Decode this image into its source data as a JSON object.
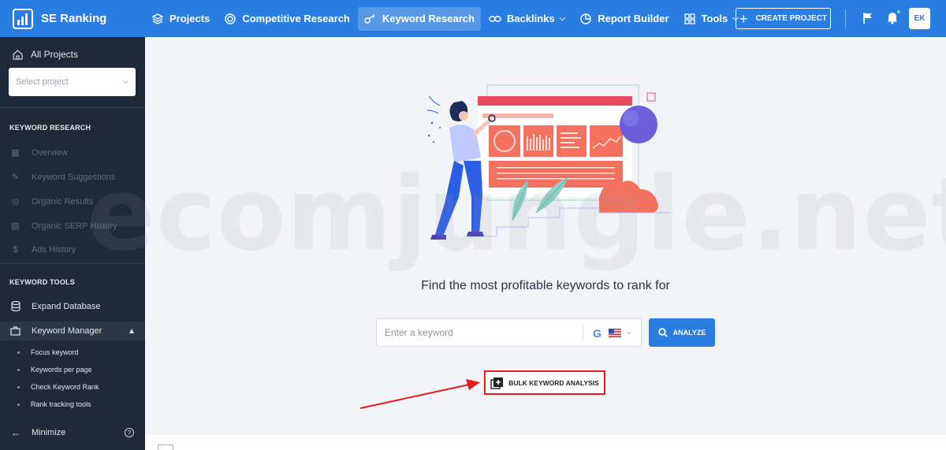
{
  "brand": {
    "name": "SE Ranking"
  },
  "nav": {
    "projects": "Projects",
    "competitive": "Competitive Research",
    "keyword": "Keyword Research",
    "backlinks": "Backlinks",
    "report": "Report Builder",
    "tools": "Tools"
  },
  "header": {
    "create_project": "CREATE PROJECT",
    "avatar_initials": "EK"
  },
  "sidebar": {
    "all_projects": "All Projects",
    "select_project_placeholder": "Select project",
    "section_research": "KEYWORD RESEARCH",
    "overview": "Overview",
    "suggestions": "Keyword Suggestions",
    "organic_results": "Organic Results",
    "serp_history": "Organic SERP History",
    "ads_history": "Ads History",
    "section_tools": "KEYWORD TOOLS",
    "expand_db": "Expand Database",
    "keyword_manager": "Keyword Manager",
    "sub_focus": "Focus keyword",
    "sub_per_page": "Keywords per page",
    "sub_check_rank": "Check Keyword Rank",
    "sub_rank_tools": "Rank tracking tools",
    "minimize": "Minimize"
  },
  "main": {
    "headline": "Find the most profitable keywords to rank for",
    "search_placeholder": "Enter a keyword",
    "analyze_label": "ANALYZE",
    "bulk_label": "BULK KEYWORD ANALYSIS"
  },
  "watermark": "ecomjungle.net",
  "colors": {
    "primary": "#2a7de1",
    "sidebar": "#1e2a38",
    "highlight": "#e01e1e"
  }
}
